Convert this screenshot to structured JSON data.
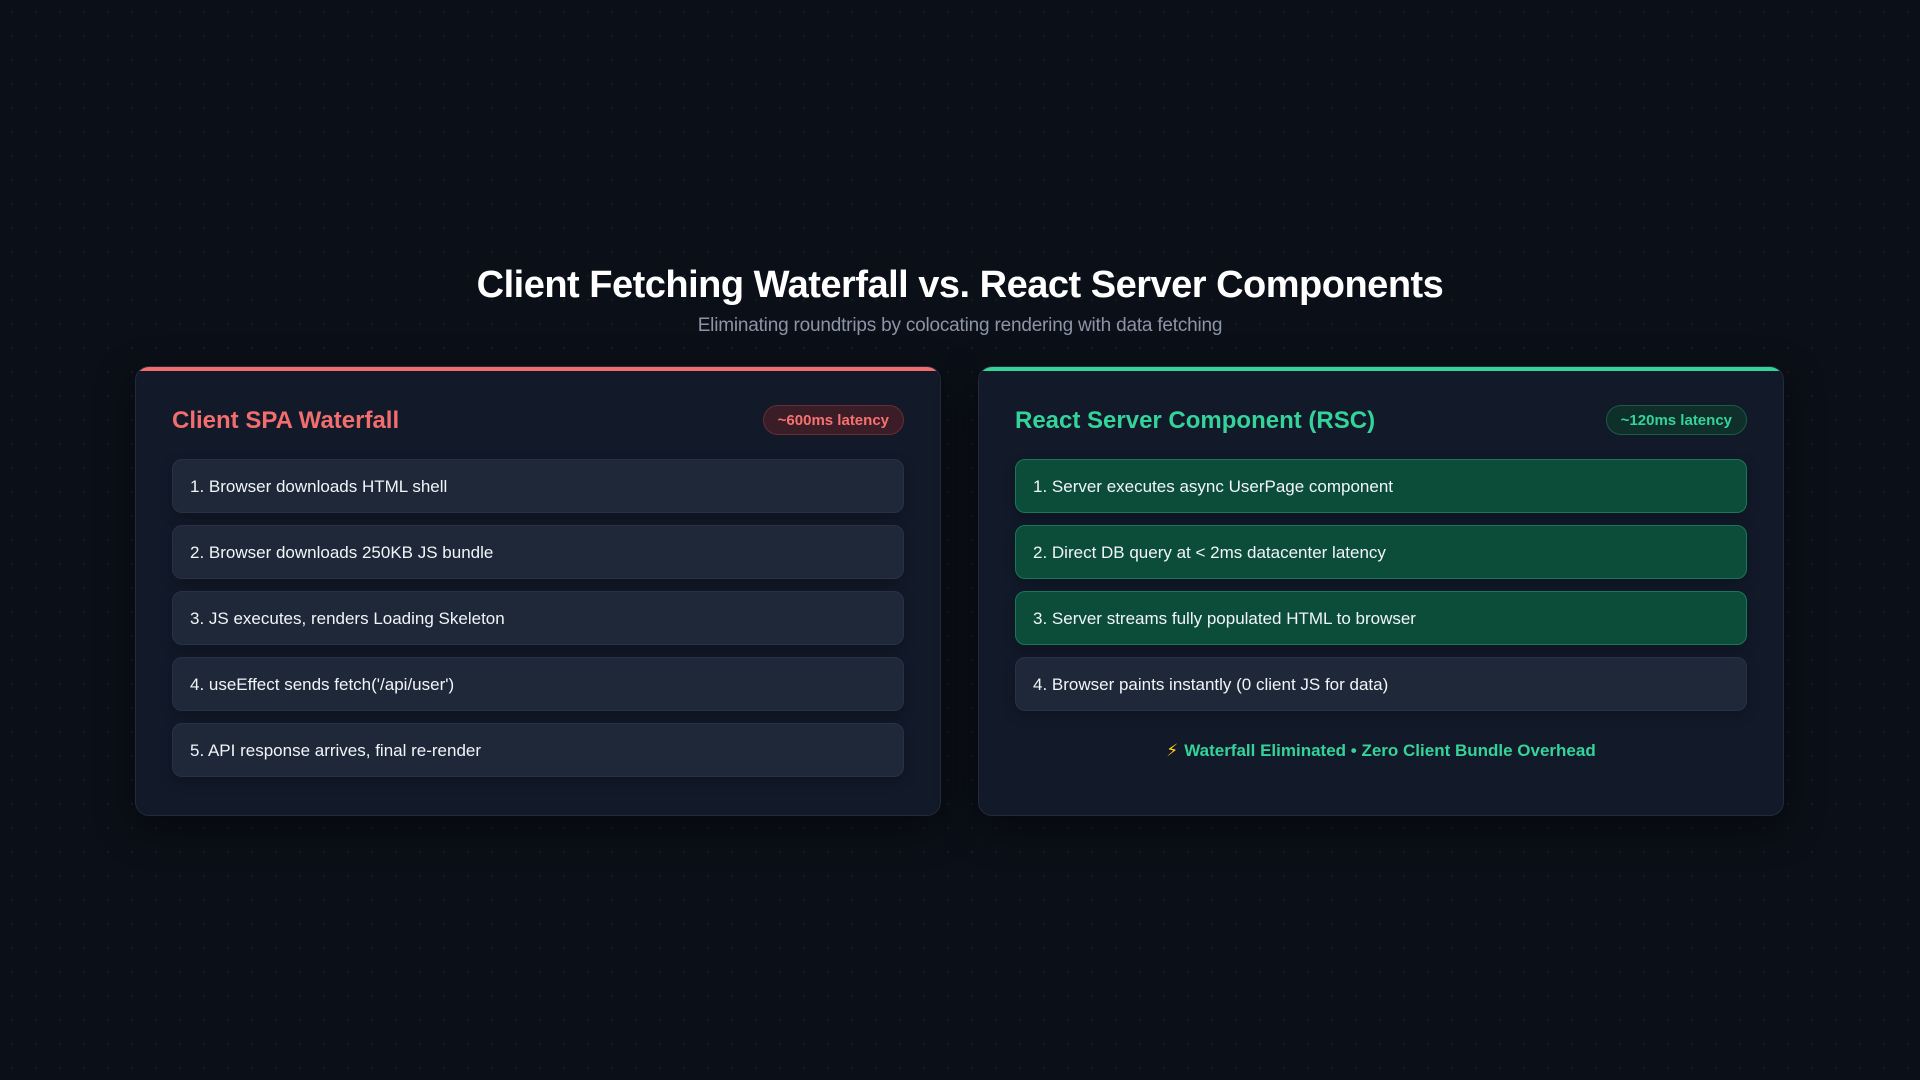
{
  "header": {
    "title": "Client Fetching Waterfall vs. React Server Components",
    "subtitle": "Eliminating roundtrips by colocating rendering with data fetching"
  },
  "left_panel": {
    "title": "Client SPA Waterfall",
    "badge": "~600ms latency",
    "accent_color": "#f26d6d",
    "steps": [
      "1. Browser downloads HTML shell",
      "2. Browser downloads 250KB JS bundle",
      "3. JS executes, renders Loading Skeleton",
      "4. useEffect sends fetch('/api/user')",
      "5. API response arrives, final re-render"
    ]
  },
  "right_panel": {
    "title": "React Server Component (RSC)",
    "badge": "~120ms latency",
    "accent_color": "#34d399",
    "steps": [
      "1. Server executes async UserPage component",
      "2. Direct DB query at < 2ms datacenter latency",
      "3. Server streams fully populated HTML to browser",
      "4. Browser paints instantly (0 client JS for data)"
    ],
    "footer_icon": "lightning-bolt-icon",
    "footer_note": "Waterfall Eliminated • Zero Client Bundle Overhead"
  }
}
